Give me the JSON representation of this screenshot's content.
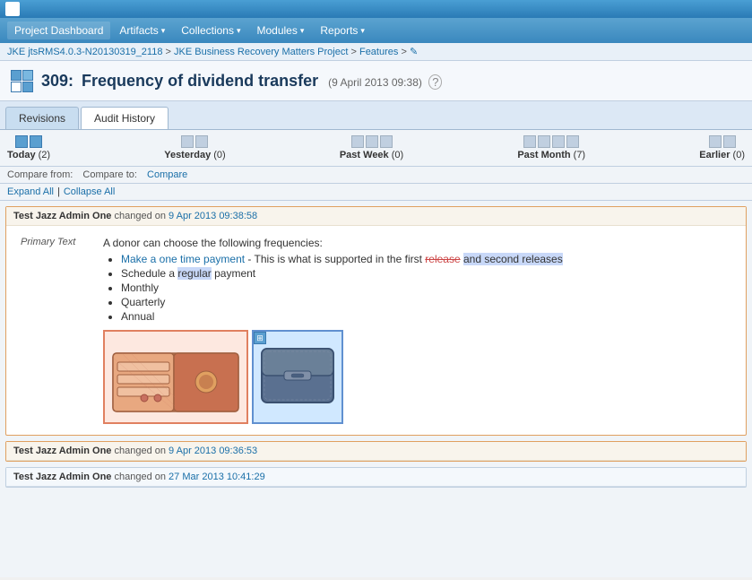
{
  "topbar": {
    "logo_alt": "JKE"
  },
  "nav": {
    "project_dashboard": "Project Dashboard",
    "artifacts": "Artifacts",
    "collections": "Collections",
    "modules": "Modules",
    "reports": "Reports"
  },
  "breadcrumb": {
    "parts": [
      "JKE jtsRMS4.0.3-N20130319_2118",
      "JKE Business Recovery Matters Project",
      "Features"
    ],
    "separator": " > "
  },
  "page": {
    "number": "309:",
    "title": "Frequency of dividend transfer",
    "meta": "(9 April 2013 09:38)",
    "help": "?"
  },
  "tabs": [
    {
      "id": "revisions",
      "label": "Revisions",
      "active": false
    },
    {
      "id": "audit-history",
      "label": "Audit History",
      "active": true
    }
  ],
  "time_periods": [
    {
      "id": "today",
      "label": "Today",
      "count": 2,
      "active": true
    },
    {
      "id": "yesterday",
      "label": "Yesterday",
      "count": 0,
      "active": false
    },
    {
      "id": "past-week",
      "label": "Past Week",
      "count": 0,
      "active": false
    },
    {
      "id": "past-month",
      "label": "Past Month",
      "count": 7,
      "active": false
    },
    {
      "id": "earlier",
      "label": "Earlier",
      "count": 0,
      "active": false
    }
  ],
  "compare": {
    "from_label": "Compare from:",
    "to_label": "Compare to:",
    "action_label": "Compare"
  },
  "expand_collapse": {
    "expand_all": "Expand All",
    "separator": "|",
    "collapse_all": "Collapse All"
  },
  "audit_entries": [
    {
      "id": "entry-1",
      "author": "Test Jazz Admin One",
      "changed_on": "changed on",
      "date": "9 Apr 2013 09:38:58",
      "field_label": "Primary Text",
      "content": {
        "intro": "A donor can choose the following frequencies:",
        "items": [
          {
            "text": "Make a one time payment",
            "suffix": " - This is what is supported in the first ",
            "strikethrough": "release",
            "highlight": "and second releases"
          },
          {
            "text": "Schedule a ",
            "highlight": "regular",
            "suffix": " payment"
          },
          {
            "text": "Monthly"
          },
          {
            "text": "Quarterly"
          },
          {
            "text": "Annual"
          }
        ],
        "has_images": true
      }
    },
    {
      "id": "entry-2",
      "author": "Test Jazz Admin One",
      "changed_on": "changed on",
      "date": "9 Apr 2013 09:36:53",
      "partial": false
    },
    {
      "id": "entry-3",
      "author": "Test Jazz Admin One",
      "changed_on": "changed on",
      "date": "27 Mar 2013 10:41:29",
      "partial": true
    }
  ]
}
